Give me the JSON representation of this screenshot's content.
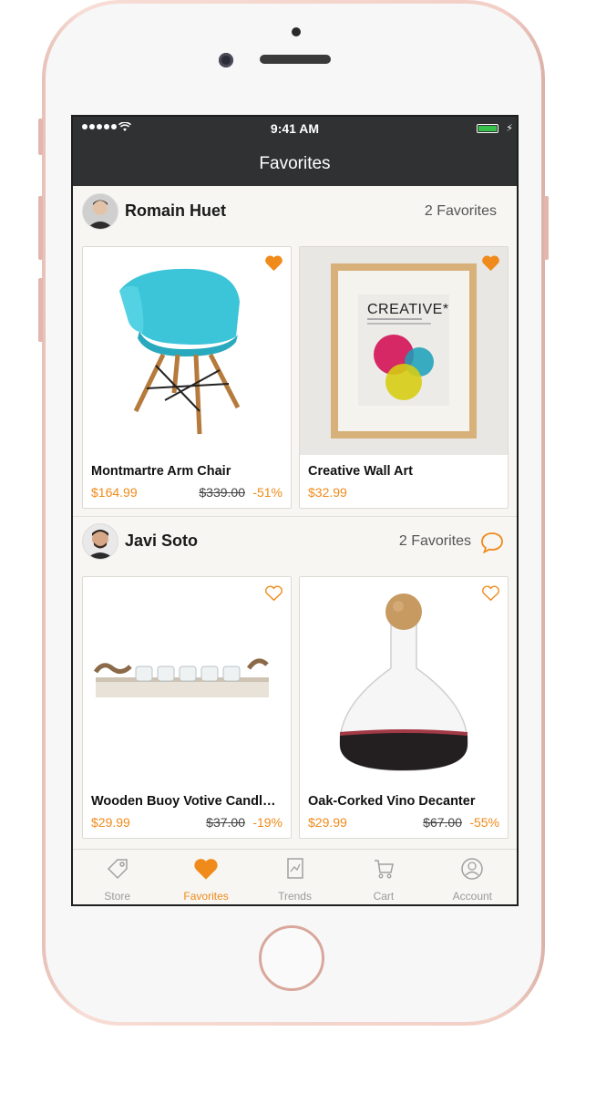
{
  "status_bar": {
    "time": "9:41 AM"
  },
  "nav": {
    "title": "Favorites"
  },
  "users": [
    {
      "name": "Romain Huet",
      "favorites_label": "2 Favorites",
      "has_comment": false,
      "products": [
        {
          "title": "Montmartre Arm Chair",
          "price": "$164.99",
          "old_price": "$339.00",
          "discount": "-51%",
          "favorited": true,
          "image": "chair"
        },
        {
          "title": "Creative Wall Art",
          "price": "$32.99",
          "old_price": "",
          "discount": "",
          "favorited": true,
          "image": "wall-art",
          "art_text": "CREATIVE*"
        }
      ]
    },
    {
      "name": "Javi Soto",
      "favorites_label": "2 Favorites",
      "has_comment": true,
      "products": [
        {
          "title": "Wooden Buoy Votive Candle…",
          "price": "$29.99",
          "old_price": "$37.00",
          "discount": "-19%",
          "favorited": false,
          "image": "candle-holder"
        },
        {
          "title": "Oak-Corked Vino Decanter",
          "price": "$29.99",
          "old_price": "$67.00",
          "discount": "-55%",
          "favorited": false,
          "image": "decanter"
        }
      ]
    }
  ],
  "tabbar": {
    "active": "Favorites",
    "tabs": [
      {
        "label": "Store",
        "icon": "tag-icon"
      },
      {
        "label": "Favorites",
        "icon": "heart-icon"
      },
      {
        "label": "Trends",
        "icon": "trends-icon"
      },
      {
        "label": "Cart",
        "icon": "cart-icon"
      },
      {
        "label": "Account",
        "icon": "account-icon"
      }
    ]
  },
  "colors": {
    "accent": "#f08a1a",
    "nav_bg": "#2f3133",
    "screen_bg": "#f7f6f3"
  }
}
